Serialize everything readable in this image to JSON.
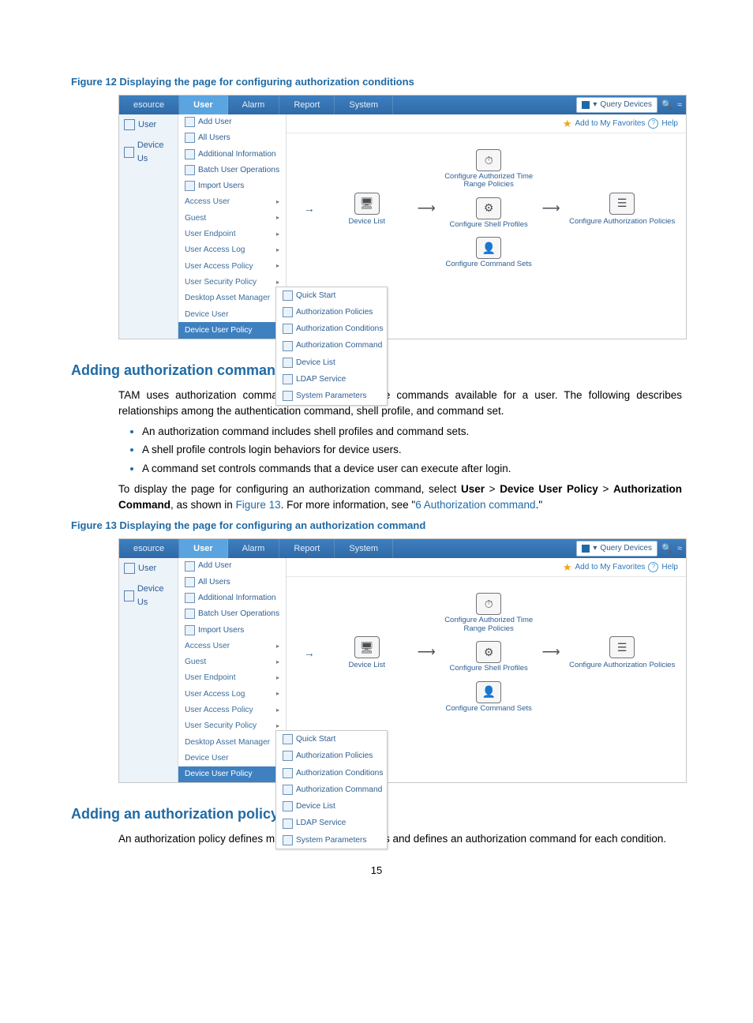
{
  "page_number": "15",
  "fig12": {
    "caption": "Figure 12 Displaying the page for configuring authorization conditions",
    "tabs": [
      "esource",
      "User",
      "Alarm",
      "Report",
      "System"
    ],
    "highlight_tab": "User",
    "search_placeholder": "Query Devices",
    "left_tabs": [
      "User",
      "Device Us"
    ],
    "top_menu": [
      "Add User",
      "All Users",
      "Additional Information",
      "Batch User Operations",
      "Import Users"
    ],
    "sub_menu": [
      "Access User",
      "Guest",
      "User Endpoint",
      "User Access Log",
      "User Access Policy",
      "User Security Policy",
      "Desktop Asset Manager",
      "Device User",
      "Device User Policy"
    ],
    "flyout": [
      "Quick Start",
      "Authorization Policies",
      "Authorization Conditions",
      "Authorization Command",
      "Device List",
      "LDAP Service",
      "System Parameters"
    ],
    "fav": "Add to My Favorites",
    "help": "Help",
    "wf": {
      "device_list": "Device List",
      "time_policies": "Configure Authorized Time\nRange Policies",
      "shell_profiles": "Configure Shell Profiles",
      "command_sets": "Configure Command Sets",
      "auth_policies": "Configure Authorization Policies"
    }
  },
  "sec1": {
    "heading": "Adding authorization command sets",
    "p1": "TAM uses authorization command sets to control the commands available for a user. The following describes relationships among the authentication command, shell profile, and command set.",
    "bullets": [
      "An authorization command includes shell profiles and command sets.",
      "A shell profile controls login behaviors for device users.",
      "A command set controls commands that a device user can execute after login."
    ],
    "p2_a": "To display the page for configuring an authorization command, select ",
    "p2_b": "User",
    "p2_c": " > ",
    "p2_d": "Device User Policy",
    "p2_e": " > ",
    "p2_f": "Authorization Command",
    "p2_g": ", as shown in ",
    "p2_fig": "Figure 13",
    "p2_h": ". For more information, see \"",
    "p2_link": "6 Authorization command",
    "p2_i": ".\""
  },
  "fig13_caption": "Figure 13 Displaying the page for configuring an authorization command",
  "sec2": {
    "heading": "Adding an authorization policy",
    "p1": "An authorization policy defines multiple access conditions and defines an authorization command for each condition."
  }
}
